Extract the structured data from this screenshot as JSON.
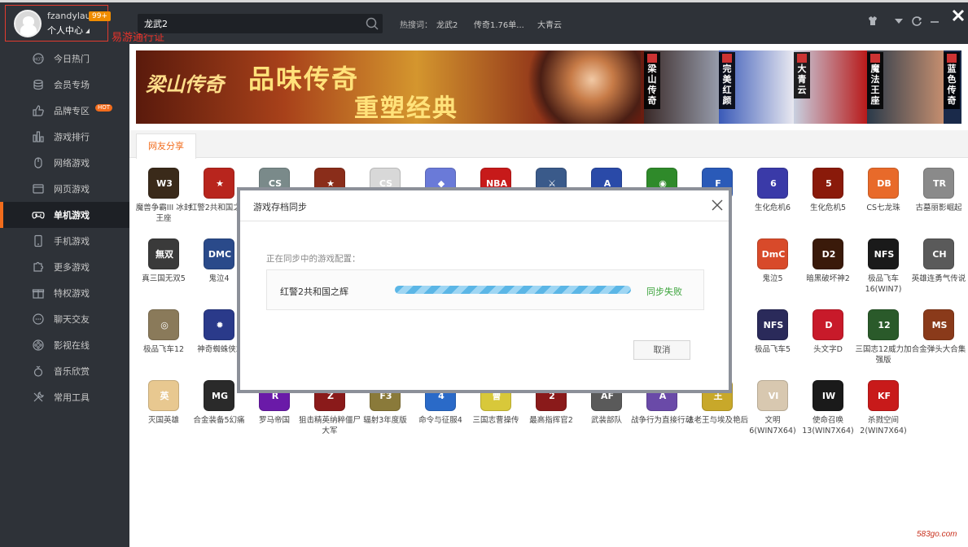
{
  "header": {
    "username": "fzandylau",
    "badge": "99+",
    "user_center": "个人中心",
    "annotation": "易游通行证",
    "search_value": "龙武2",
    "hot_label": "热搜词：",
    "hot_words": [
      "龙武2",
      "传奇1.76单...",
      "大青云"
    ]
  },
  "sidebar": {
    "items": [
      {
        "label": "今日热门",
        "icon": "hot-icon"
      },
      {
        "label": "会员专场",
        "icon": "coins-icon"
      },
      {
        "label": "品牌专区",
        "icon": "thumbs-up-icon",
        "tag": "HOT"
      },
      {
        "label": "游戏排行",
        "icon": "bar-chart-icon"
      },
      {
        "label": "网络游戏",
        "icon": "mouse-icon"
      },
      {
        "label": "网页游戏",
        "icon": "browser-icon"
      },
      {
        "label": "单机游戏",
        "icon": "gamepad-icon",
        "active": true
      },
      {
        "label": "手机游戏",
        "icon": "phone-icon"
      },
      {
        "label": "更多游戏",
        "icon": "puzzle-icon"
      },
      {
        "label": "特权游戏",
        "icon": "gift-icon"
      },
      {
        "label": "聊天交友",
        "icon": "chat-icon"
      },
      {
        "label": "影视在线",
        "icon": "film-icon"
      },
      {
        "label": "音乐欣赏",
        "icon": "music-icon"
      },
      {
        "label": "常用工具",
        "icon": "tools-icon"
      }
    ]
  },
  "banner": {
    "logo": "梁山传奇",
    "headline1": "品味传奇",
    "headline2": "重塑经典",
    "promos": [
      "梁山传奇",
      "完美红颜",
      "大青云",
      "魔法王座",
      "蓝色传奇"
    ]
  },
  "tabs": {
    "active": "网友分享"
  },
  "games": [
    {
      "name": "魔兽争霸III 冰封王座",
      "color": "#3a2a1a",
      "glyph": "W3"
    },
    {
      "name": "红警2共和国之辉",
      "color": "#b8251d",
      "glyph": "★"
    },
    {
      "name": "",
      "color": "#7a8a8a",
      "glyph": "CS"
    },
    {
      "name": "",
      "color": "#8a2d1a",
      "glyph": "★"
    },
    {
      "name": "",
      "color": "#d8d8d8",
      "glyph": "CS"
    },
    {
      "name": "",
      "color": "#6a7ad8",
      "glyph": "◆"
    },
    {
      "name": "",
      "color": "#c71a1a",
      "glyph": "NBA"
    },
    {
      "name": "",
      "color": "#3a5a8a",
      "glyph": "⚔"
    },
    {
      "name": "",
      "color": "#2a4aa8",
      "glyph": "A"
    },
    {
      "name": "",
      "color": "#2f8a2a",
      "glyph": "◉"
    },
    {
      "name": "",
      "color": "#2a5ab8",
      "glyph": "F"
    },
    {
      "name": "生化危机6",
      "color": "#3a3aa8",
      "glyph": "6"
    },
    {
      "name": "生化危机5",
      "color": "#8a1a0a",
      "glyph": "5"
    },
    {
      "name": "CS七龙珠",
      "color": "#e86a2a",
      "glyph": "DB"
    },
    {
      "name": "古墓丽影崛起",
      "color": "#8a8a8a",
      "glyph": "TR"
    },
    {
      "name": "真三国无双5",
      "color": "#3a3a3a",
      "glyph": "無双"
    },
    {
      "name": "鬼泣4",
      "color": "#2a4a8a",
      "glyph": "DMC"
    },
    {
      "name": "鬼泣5",
      "color": "#d84a2a",
      "glyph": "DmC"
    },
    {
      "name": "暗黑破坏神2",
      "color": "#3a1a0a",
      "glyph": "D2"
    },
    {
      "name": "极品飞车16(WIN7)",
      "color": "#1a1a1a",
      "glyph": "NFS"
    },
    {
      "name": "英雄连勇气传说",
      "color": "#5a5a5a",
      "glyph": "CH"
    },
    {
      "name": "极品飞车12",
      "color": "#8a7a5a",
      "glyph": "◎"
    },
    {
      "name": "神奇蜘蛛侠2",
      "color": "#2a3a8a",
      "glyph": "✹"
    },
    {
      "name": "极品飞车5",
      "color": "#2a2a5a",
      "glyph": "NFS"
    },
    {
      "name": "头文字D",
      "color": "#c81a2a",
      "glyph": "D"
    },
    {
      "name": "三国志12威力加强版",
      "color": "#2a5a2a",
      "glyph": "12"
    },
    {
      "name": "合金弹头大合集",
      "color": "#8a3a1a",
      "glyph": "MS"
    },
    {
      "name": "灭国英雄",
      "color": "#e8c890",
      "glyph": "英"
    },
    {
      "name": "合金装备5幻痛",
      "color": "#2a2a2a",
      "glyph": "MG"
    },
    {
      "name": "罗马帝国",
      "color": "#6a1aa8",
      "glyph": "R"
    },
    {
      "name": "狙击精英纳粹僵尸大军",
      "color": "#8a1a1a",
      "glyph": "Z"
    },
    {
      "name": "辐射3年度版",
      "color": "#8a7a3a",
      "glyph": "F3"
    },
    {
      "name": "命令与征服4",
      "color": "#2a6ac8",
      "glyph": "4"
    },
    {
      "name": "三国志曹操传",
      "color": "#d8c83a",
      "glyph": "曹"
    },
    {
      "name": "最高指挥官2",
      "color": "#8a1a1a",
      "glyph": "2"
    },
    {
      "name": "武装部队",
      "color": "#5a5a5a",
      "glyph": "AF"
    },
    {
      "name": "战争行为直接行动",
      "color": "#6a4aa8",
      "glyph": "A"
    },
    {
      "name": "法老王与埃及艳后",
      "color": "#c8a82a",
      "glyph": "王"
    },
    {
      "name": "文明6(WIN7X64)",
      "color": "#d8c8b0",
      "glyph": "VI"
    },
    {
      "name": "使命召唤13(WIN7X64)",
      "color": "#1a1a1a",
      "glyph": "IW"
    },
    {
      "name": "杀戮空间2(WIN7X64)",
      "color": "#c81a1a",
      "glyph": "KF"
    }
  ],
  "modal": {
    "title": "游戏存档同步",
    "subtitle": "正在同步中的游戏配置：",
    "game": "红警2共和国之辉",
    "status": "同步失败",
    "progress": 1.0,
    "cancel": "取消"
  },
  "watermark": "583go.com",
  "colors": {
    "accent": "#f26c1c",
    "sidebar_bg": "#2e3238",
    "success": "#3aa33a",
    "annotation_red": "#e8322a"
  }
}
